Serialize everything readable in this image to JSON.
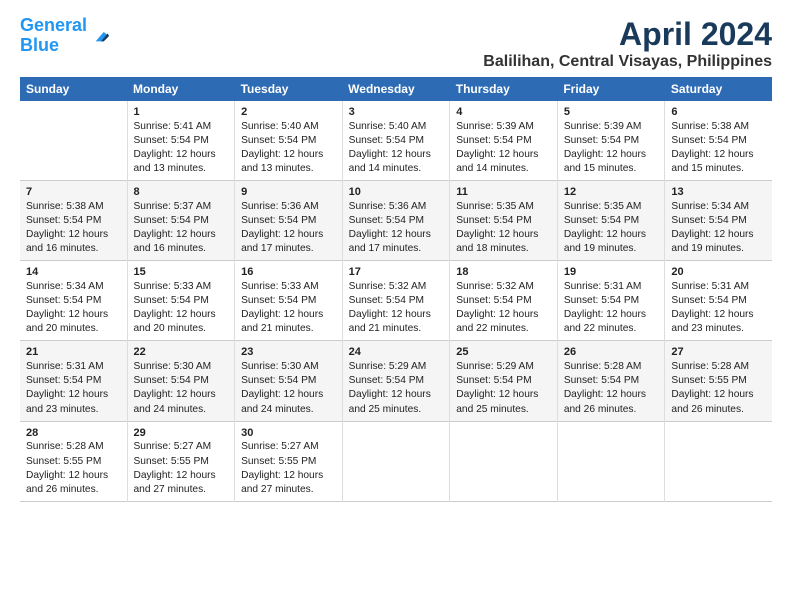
{
  "logo": {
    "line1": "General",
    "line2": "Blue"
  },
  "title": "April 2024",
  "subtitle": "Balilihan, Central Visayas, Philippines",
  "headers": [
    "Sunday",
    "Monday",
    "Tuesday",
    "Wednesday",
    "Thursday",
    "Friday",
    "Saturday"
  ],
  "weeks": [
    [
      {
        "day": "",
        "content": ""
      },
      {
        "day": "1",
        "content": "Sunrise: 5:41 AM\nSunset: 5:54 PM\nDaylight: 12 hours\nand 13 minutes."
      },
      {
        "day": "2",
        "content": "Sunrise: 5:40 AM\nSunset: 5:54 PM\nDaylight: 12 hours\nand 13 minutes."
      },
      {
        "day": "3",
        "content": "Sunrise: 5:40 AM\nSunset: 5:54 PM\nDaylight: 12 hours\nand 14 minutes."
      },
      {
        "day": "4",
        "content": "Sunrise: 5:39 AM\nSunset: 5:54 PM\nDaylight: 12 hours\nand 14 minutes."
      },
      {
        "day": "5",
        "content": "Sunrise: 5:39 AM\nSunset: 5:54 PM\nDaylight: 12 hours\nand 15 minutes."
      },
      {
        "day": "6",
        "content": "Sunrise: 5:38 AM\nSunset: 5:54 PM\nDaylight: 12 hours\nand 15 minutes."
      }
    ],
    [
      {
        "day": "7",
        "content": "Sunrise: 5:38 AM\nSunset: 5:54 PM\nDaylight: 12 hours\nand 16 minutes."
      },
      {
        "day": "8",
        "content": "Sunrise: 5:37 AM\nSunset: 5:54 PM\nDaylight: 12 hours\nand 16 minutes."
      },
      {
        "day": "9",
        "content": "Sunrise: 5:36 AM\nSunset: 5:54 PM\nDaylight: 12 hours\nand 17 minutes."
      },
      {
        "day": "10",
        "content": "Sunrise: 5:36 AM\nSunset: 5:54 PM\nDaylight: 12 hours\nand 17 minutes."
      },
      {
        "day": "11",
        "content": "Sunrise: 5:35 AM\nSunset: 5:54 PM\nDaylight: 12 hours\nand 18 minutes."
      },
      {
        "day": "12",
        "content": "Sunrise: 5:35 AM\nSunset: 5:54 PM\nDaylight: 12 hours\nand 19 minutes."
      },
      {
        "day": "13",
        "content": "Sunrise: 5:34 AM\nSunset: 5:54 PM\nDaylight: 12 hours\nand 19 minutes."
      }
    ],
    [
      {
        "day": "14",
        "content": "Sunrise: 5:34 AM\nSunset: 5:54 PM\nDaylight: 12 hours\nand 20 minutes."
      },
      {
        "day": "15",
        "content": "Sunrise: 5:33 AM\nSunset: 5:54 PM\nDaylight: 12 hours\nand 20 minutes."
      },
      {
        "day": "16",
        "content": "Sunrise: 5:33 AM\nSunset: 5:54 PM\nDaylight: 12 hours\nand 21 minutes."
      },
      {
        "day": "17",
        "content": "Sunrise: 5:32 AM\nSunset: 5:54 PM\nDaylight: 12 hours\nand 21 minutes."
      },
      {
        "day": "18",
        "content": "Sunrise: 5:32 AM\nSunset: 5:54 PM\nDaylight: 12 hours\nand 22 minutes."
      },
      {
        "day": "19",
        "content": "Sunrise: 5:31 AM\nSunset: 5:54 PM\nDaylight: 12 hours\nand 22 minutes."
      },
      {
        "day": "20",
        "content": "Sunrise: 5:31 AM\nSunset: 5:54 PM\nDaylight: 12 hours\nand 23 minutes."
      }
    ],
    [
      {
        "day": "21",
        "content": "Sunrise: 5:31 AM\nSunset: 5:54 PM\nDaylight: 12 hours\nand 23 minutes."
      },
      {
        "day": "22",
        "content": "Sunrise: 5:30 AM\nSunset: 5:54 PM\nDaylight: 12 hours\nand 24 minutes."
      },
      {
        "day": "23",
        "content": "Sunrise: 5:30 AM\nSunset: 5:54 PM\nDaylight: 12 hours\nand 24 minutes."
      },
      {
        "day": "24",
        "content": "Sunrise: 5:29 AM\nSunset: 5:54 PM\nDaylight: 12 hours\nand 25 minutes."
      },
      {
        "day": "25",
        "content": "Sunrise: 5:29 AM\nSunset: 5:54 PM\nDaylight: 12 hours\nand 25 minutes."
      },
      {
        "day": "26",
        "content": "Sunrise: 5:28 AM\nSunset: 5:54 PM\nDaylight: 12 hours\nand 26 minutes."
      },
      {
        "day": "27",
        "content": "Sunrise: 5:28 AM\nSunset: 5:55 PM\nDaylight: 12 hours\nand 26 minutes."
      }
    ],
    [
      {
        "day": "28",
        "content": "Sunrise: 5:28 AM\nSunset: 5:55 PM\nDaylight: 12 hours\nand 26 minutes."
      },
      {
        "day": "29",
        "content": "Sunrise: 5:27 AM\nSunset: 5:55 PM\nDaylight: 12 hours\nand 27 minutes."
      },
      {
        "day": "30",
        "content": "Sunrise: 5:27 AM\nSunset: 5:55 PM\nDaylight: 12 hours\nand 27 minutes."
      },
      {
        "day": "",
        "content": ""
      },
      {
        "day": "",
        "content": ""
      },
      {
        "day": "",
        "content": ""
      },
      {
        "day": "",
        "content": ""
      }
    ]
  ]
}
